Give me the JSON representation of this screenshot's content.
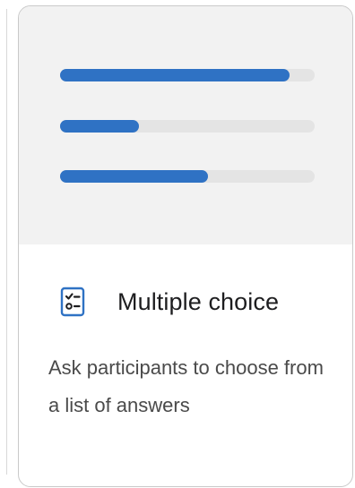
{
  "card": {
    "title": "Multiple choice",
    "description": "Ask participants to choose from a list of answers",
    "icon": "checklist-icon"
  },
  "preview": {
    "bars": [
      {
        "fill": 0.9
      },
      {
        "fill": 0.31
      },
      {
        "fill": 0.58
      }
    ]
  },
  "colors": {
    "accent": "#2f72c4",
    "preview_bg": "#f2f2f2",
    "track": "#e4e4e4",
    "text": "#1d1d1f",
    "muted_text": "#4a4a4a"
  }
}
